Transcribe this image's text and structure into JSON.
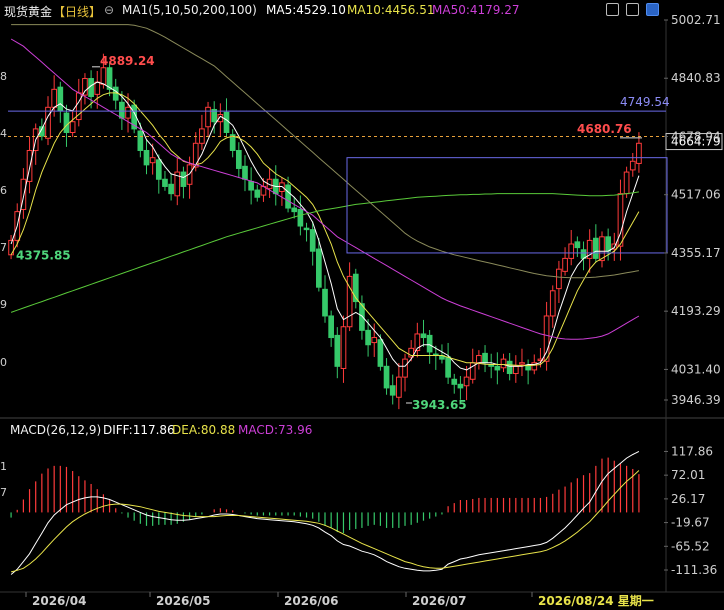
{
  "header": {
    "instrument": "现货黄金",
    "period": "【日线】",
    "ma_label": "MA1(5,10,50,200,100)",
    "ma5": "MA5:4529.10",
    "ma10": "MA10:4456.51",
    "ma50": "MA50:4179.27"
  },
  "macd_header": {
    "label": "MACD(26,12,9)",
    "diff": "DIFF:117.86",
    "dea": "DEA:80.88",
    "macd": "MACD:73.96"
  },
  "icons": [
    "settings-icon",
    "close-icon",
    "toggle-icon"
  ],
  "colors": {
    "up": "#ff3b3b",
    "down": "#36c96a",
    "ma5": "#ffffff",
    "ma10": "#e8e34a",
    "ma50": "#cc3fd6",
    "ma_long": "#5aca3a",
    "ma_mid": "#8a8a5a",
    "hline": "#6a6ae8"
  },
  "chart_data": [
    {
      "type": "candlestick",
      "title": "现货黄金 日线",
      "y_axis_ticks": [
        "5002.71",
        "4840.83",
        "4678.94",
        "4517.06",
        "4355.17",
        "4193.29",
        "4031.40",
        "3946.39"
      ],
      "left_tick_fragments": [
        "8",
        "4",
        "6",
        "7",
        "9",
        "0"
      ],
      "ylim": [
        3946.39,
        5002.71
      ],
      "x_axis_labels": [
        "2026/04",
        "2026/05",
        "2026/06",
        "2026/07",
        "2026/08/24 星期一"
      ],
      "annotations": {
        "high": "4889.24",
        "low_left": "4375.85",
        "low": "3943.65",
        "resistance": "4749.54",
        "recent_high": "4680.76",
        "last_price": "4664.79"
      },
      "closes": [
        4390,
        4470,
        4560,
        4640,
        4700,
        4680,
        4760,
        4810,
        4750,
        4690,
        4720,
        4800,
        4840,
        4790,
        4830,
        4870,
        4810,
        4780,
        4730,
        4760,
        4700,
        4640,
        4600,
        4620,
        4560,
        4540,
        4520,
        4580,
        4540,
        4600,
        4660,
        4700,
        4760,
        4720,
        4740,
        4690,
        4640,
        4590,
        4560,
        4530,
        4510,
        4540,
        4560,
        4520,
        4550,
        4480,
        4470,
        4430,
        4420,
        4360,
        4260,
        4180,
        4120,
        4040,
        4150,
        4290,
        4220,
        4140,
        4100,
        4120,
        4040,
        3980,
        3960,
        4010,
        4060,
        4090,
        4130,
        4120,
        4080,
        4070,
        4060,
        4010,
        3990,
        3980,
        4010,
        4050,
        4070,
        4050,
        4040,
        4030,
        4060,
        4020,
        4040,
        4050,
        4030,
        4050,
        4060,
        4180,
        4250,
        4310,
        4340,
        4380,
        4370,
        4340,
        4390,
        4340,
        4400,
        4360,
        4380,
        4520,
        4580,
        4610,
        4660
      ],
      "series": [
        {
          "name": "MA5",
          "values": [
            4380,
            4430,
            4510,
            4590,
            4670,
            4700,
            4735,
            4760,
            4770,
            4755,
            4750,
            4775,
            4805,
            4820,
            4830,
            4825,
            4815,
            4805,
            4790,
            4770,
            4745,
            4710,
            4670,
            4650,
            4620,
            4595,
            4575,
            4570,
            4565,
            4575,
            4600,
            4630,
            4670,
            4710,
            4735,
            4725,
            4710,
            4680,
            4645,
            4610,
            4580,
            4555,
            4545,
            4540,
            4540,
            4525,
            4510,
            4490,
            4470,
            4440,
            4390,
            4330,
            4270,
            4200,
            4170,
            4180,
            4190,
            4180,
            4160,
            4140,
            4120,
            4090,
            4060,
            4040,
            4040,
            4060,
            4090,
            4100,
            4100,
            4090,
            4080,
            4070,
            4050,
            4035,
            4030,
            4040,
            4050,
            4050,
            4050,
            4045,
            4045,
            4040,
            4040,
            4040,
            4045,
            4045,
            4050,
            4080,
            4130,
            4190,
            4240,
            4290,
            4320,
            4340,
            4350,
            4360,
            4360,
            4360,
            4370,
            4410,
            4470,
            4520,
            4570
          ]
        },
        {
          "name": "MA10",
          "values": [
            4350,
            4380,
            4420,
            4470,
            4530,
            4580,
            4620,
            4660,
            4690,
            4710,
            4725,
            4740,
            4755,
            4770,
            4785,
            4795,
            4800,
            4800,
            4795,
            4785,
            4770,
            4750,
            4730,
            4710,
            4685,
            4665,
            4640,
            4625,
            4610,
            4605,
            4600,
            4605,
            4620,
            4640,
            4665,
            4675,
            4680,
            4675,
            4665,
            4650,
            4630,
            4605,
            4590,
            4575,
            4565,
            4555,
            4540,
            4525,
            4510,
            4490,
            4460,
            4420,
            4380,
            4330,
            4290,
            4260,
            4230,
            4210,
            4190,
            4170,
            4150,
            4130,
            4110,
            4090,
            4080,
            4070,
            4070,
            4070,
            4070,
            4070,
            4070,
            4065,
            4060,
            4055,
            4050,
            4050,
            4048,
            4046,
            4045,
            4045,
            4045,
            4044,
            4043,
            4042,
            4042,
            4043,
            4045,
            4060,
            4090,
            4130,
            4170,
            4210,
            4250,
            4280,
            4310,
            4330,
            4340,
            4350,
            4360,
            4380,
            4410,
            4440,
            4470
          ]
        },
        {
          "name": "MA50",
          "values": [
            4950,
            4940,
            4930,
            4915,
            4900,
            4885,
            4870,
            4855,
            4840,
            4825,
            4810,
            4800,
            4790,
            4780,
            4770,
            4760,
            4750,
            4740,
            4730,
            4720,
            4710,
            4700,
            4690,
            4675,
            4660,
            4645,
            4630,
            4620,
            4612,
            4605,
            4600,
            4595,
            4590,
            4585,
            4580,
            4575,
            4570,
            4565,
            4560,
            4555,
            4550,
            4540,
            4530,
            4520,
            4510,
            4500,
            4490,
            4480,
            4470,
            4460,
            4445,
            4430,
            4415,
            4400,
            4390,
            4380,
            4370,
            4360,
            4350,
            4340,
            4330,
            4320,
            4310,
            4300,
            4290,
            4280,
            4270,
            4260,
            4250,
            4240,
            4230,
            4222,
            4215,
            4208,
            4202,
            4196,
            4190,
            4184,
            4178,
            4172,
            4166,
            4160,
            4154,
            4148,
            4142,
            4136,
            4130,
            4126,
            4122,
            4118,
            4116,
            4115,
            4115,
            4116,
            4118,
            4120,
            4124,
            4130,
            4140,
            4150,
            4160,
            4170,
            4180
          ]
        },
        {
          "name": "MA_long",
          "values": [
            4190,
            4196,
            4202,
            4208,
            4214,
            4220,
            4226,
            4232,
            4238,
            4244,
            4250,
            4256,
            4262,
            4268,
            4274,
            4280,
            4286,
            4292,
            4298,
            4304,
            4310,
            4316,
            4322,
            4328,
            4334,
            4340,
            4346,
            4352,
            4358,
            4364,
            4370,
            4376,
            4382,
            4388,
            4394,
            4400,
            4405,
            4410,
            4415,
            4420,
            4425,
            4430,
            4435,
            4440,
            4445,
            4450,
            4455,
            4460,
            4464,
            4468,
            4472,
            4475,
            4478,
            4481,
            4484,
            4487,
            4490,
            4492,
            4494,
            4496,
            4498,
            4500,
            4502,
            4504,
            4506,
            4508,
            4510,
            4511,
            4512,
            4513,
            4514,
            4515,
            4516,
            4517,
            4517,
            4518,
            4518,
            4519,
            4519,
            4520,
            4520,
            4520,
            4520,
            4520,
            4520,
            4520,
            4520,
            4520,
            4520,
            4519,
            4518,
            4517,
            4516,
            4515,
            4514,
            4514,
            4514,
            4515,
            4516,
            4518,
            4520,
            4522,
            4525
          ]
        },
        {
          "name": "MA_mid",
          "values": [
            4990,
            4990,
            4990,
            4990,
            4990,
            4990,
            4990,
            4990,
            4990,
            4990,
            4990,
            4990,
            4990,
            4990,
            4990,
            4990,
            4990,
            4990,
            4990,
            4990,
            4988,
            4984,
            4980,
            4972,
            4964,
            4955,
            4945,
            4935,
            4925,
            4915,
            4905,
            4895,
            4885,
            4875,
            4860,
            4845,
            4830,
            4815,
            4800,
            4785,
            4770,
            4755,
            4740,
            4725,
            4710,
            4695,
            4680,
            4665,
            4650,
            4635,
            4620,
            4605,
            4590,
            4575,
            4560,
            4545,
            4530,
            4515,
            4500,
            4485,
            4470,
            4455,
            4440,
            4425,
            4410,
            4398,
            4388,
            4380,
            4372,
            4366,
            4360,
            4355,
            4350,
            4346,
            4342,
            4338,
            4334,
            4330,
            4326,
            4322,
            4318,
            4314,
            4310,
            4306,
            4302,
            4298,
            4295,
            4292,
            4290,
            4288,
            4287,
            4286,
            4286,
            4286,
            4287,
            4288,
            4290,
            4292,
            4294,
            4297,
            4300,
            4303,
            4306
          ]
        }
      ]
    },
    {
      "type": "macd",
      "title": "MACD(26,12,9)",
      "y_axis_ticks": [
        "117.86",
        "72.01",
        "26.17",
        "-19.67",
        "-65.52",
        "-111.36"
      ],
      "left_tick_fragments": [
        "1",
        "7"
      ],
      "ylim": [
        -150,
        140
      ],
      "series": [
        {
          "name": "DIFF",
          "values": [
            -120,
            -110,
            -95,
            -80,
            -60,
            -40,
            -20,
            -5,
            5,
            15,
            20,
            25,
            28,
            30,
            30,
            28,
            25,
            20,
            15,
            10,
            5,
            0,
            -5,
            -8,
            -10,
            -12,
            -14,
            -15,
            -15,
            -14,
            -12,
            -10,
            -8,
            -5,
            -3,
            -3,
            -4,
            -6,
            -8,
            -10,
            -12,
            -13,
            -14,
            -15,
            -16,
            -17,
            -18,
            -20,
            -22,
            -25,
            -30,
            -38,
            -45,
            -55,
            -62,
            -65,
            -70,
            -75,
            -78,
            -82,
            -88,
            -95,
            -100,
            -105,
            -108,
            -110,
            -112,
            -113,
            -113,
            -112,
            -110,
            -100,
            -95,
            -90,
            -88,
            -85,
            -82,
            -80,
            -78,
            -76,
            -74,
            -72,
            -70,
            -68,
            -66,
            -64,
            -62,
            -58,
            -50,
            -40,
            -30,
            -18,
            -5,
            8,
            20,
            40,
            60,
            75,
            85,
            95,
            105,
            112,
            118
          ]
        },
        {
          "name": "DEA",
          "values": [
            -115,
            -112,
            -108,
            -100,
            -90,
            -78,
            -65,
            -52,
            -40,
            -28,
            -18,
            -10,
            -3,
            3,
            8,
            12,
            15,
            16,
            16,
            15,
            13,
            11,
            8,
            5,
            2,
            0,
            -2,
            -4,
            -6,
            -7,
            -8,
            -8,
            -8,
            -8,
            -7,
            -6,
            -6,
            -6,
            -7,
            -8,
            -9,
            -10,
            -11,
            -12,
            -13,
            -14,
            -15,
            -16,
            -17,
            -19,
            -21,
            -25,
            -30,
            -36,
            -42,
            -48,
            -54,
            -60,
            -65,
            -70,
            -75,
            -80,
            -85,
            -90,
            -95,
            -98,
            -102,
            -105,
            -107,
            -108,
            -108,
            -106,
            -104,
            -102,
            -100,
            -98,
            -96,
            -94,
            -92,
            -90,
            -88,
            -86,
            -84,
            -82,
            -80,
            -78,
            -76,
            -73,
            -68,
            -62,
            -55,
            -47,
            -38,
            -28,
            -18,
            -5,
            8,
            22,
            35,
            48,
            60,
            70,
            81
          ]
        },
        {
          "name": "MACD",
          "values": [
            -10,
            5,
            25,
            45,
            60,
            75,
            85,
            90,
            90,
            88,
            80,
            70,
            62,
            55,
            45,
            35,
            25,
            8,
            -2,
            -10,
            -16,
            -22,
            -26,
            -26,
            -24,
            -24,
            -24,
            -22,
            -18,
            -14,
            -8,
            -4,
            0,
            6,
            8,
            6,
            4,
            0,
            -2,
            -4,
            -6,
            -6,
            -6,
            -6,
            -6,
            -6,
            -6,
            -8,
            -10,
            -12,
            -18,
            -26,
            -30,
            -38,
            -40,
            -34,
            -32,
            -30,
            -26,
            -24,
            -26,
            -30,
            -30,
            -30,
            -26,
            -24,
            -20,
            -16,
            -12,
            -8,
            -4,
            12,
            18,
            24,
            24,
            26,
            28,
            28,
            28,
            28,
            28,
            28,
            28,
            28,
            28,
            28,
            28,
            30,
            36,
            44,
            50,
            58,
            66,
            72,
            76,
            90,
            104,
            106,
            100,
            94,
            90,
            84,
            74
          ]
        }
      ]
    }
  ]
}
